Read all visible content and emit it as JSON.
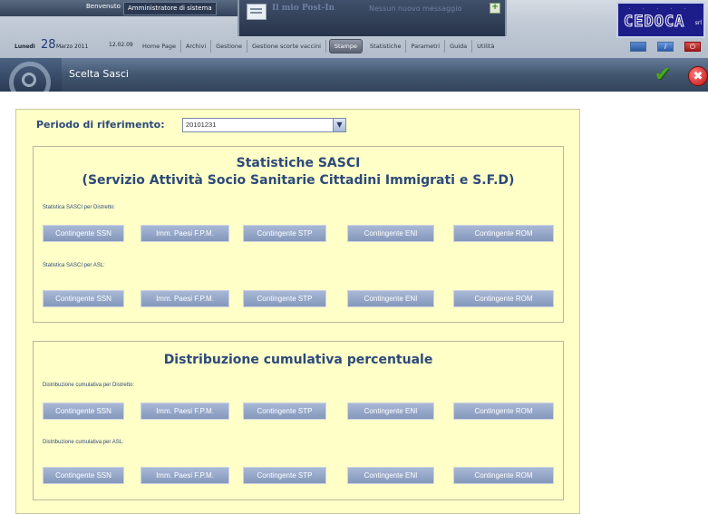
{
  "topbar": {
    "welcome_label": "Benvenuto",
    "user": "Amministratore di sistema",
    "postin": {
      "title": "Il mio Post-In",
      "message": "Nessun nuovo messaggio",
      "add": "+"
    },
    "logo": {
      "text": "CEDOCA",
      "suffix": "srl",
      "dots": "· · · · ·"
    },
    "date": {
      "weekday": "Lunedì",
      "day": "28",
      "month_year": "Marzo 2011"
    },
    "time": "12.02.09",
    "menu": [
      "Home Page",
      "Archivi",
      "Gestione",
      "Gestione scorte vaccini",
      "Stampe",
      "Statistiche",
      "Parametri",
      "Guida",
      "Utilità"
    ],
    "active_menu": "Stampe",
    "tool_icons": [
      "monitor-icon",
      "info-icon",
      "power-icon"
    ],
    "info_glyph": "i",
    "power_glyph": "⏻"
  },
  "titlebar": {
    "title": "Scelta Sasci",
    "confirm_glyph": "✔",
    "close_glyph": "✖"
  },
  "form": {
    "period_label": "Periodo di riferimento:",
    "period_value": "20101231",
    "dropdown_glyph": "▼"
  },
  "section1": {
    "title_line1": "Statistiche SASCI",
    "title_line2": "(Servizio Attività Socio Sanitarie Cittadini Immigrati e S.F.D)",
    "sub_distretto": "Statistica SASCI per Distretto:",
    "sub_asl": "Statistica SASCI per ASL:"
  },
  "section2": {
    "title": "Distribuzione cumulativa percentuale",
    "sub_distretto": "Distribuzione cumulativa per Distretto:",
    "sub_asl": "Distribuzione cumulativa per ASL:"
  },
  "buttons": [
    "Contingente SSN",
    "Imm. Paesi F.P.M.",
    "Contingente STP",
    "Contingente ENI",
    "Contingente ROM"
  ],
  "colors": {
    "panel_bg": "#ffffc8",
    "heading": "#2c4a7a",
    "button": "#8597bb",
    "titlebar": "#42566f"
  }
}
